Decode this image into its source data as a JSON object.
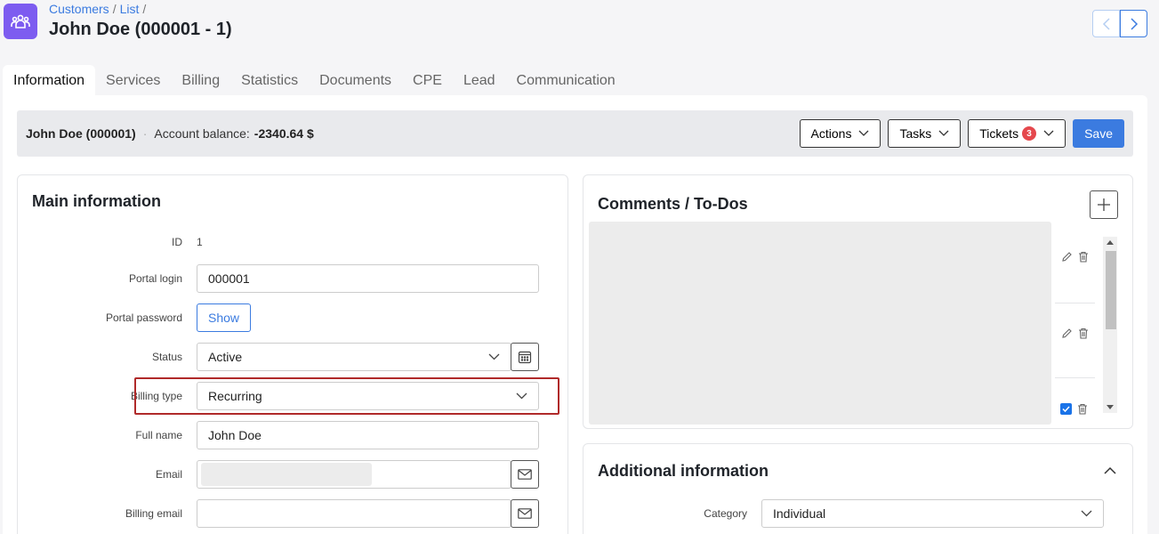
{
  "breadcrumb": {
    "customers": "Customers",
    "list": "List",
    "sep": "/"
  },
  "page": {
    "title": "John Doe (000001 - 1)"
  },
  "tabs": [
    {
      "label": "Information"
    },
    {
      "label": "Services"
    },
    {
      "label": "Billing"
    },
    {
      "label": "Statistics"
    },
    {
      "label": "Documents"
    },
    {
      "label": "CPE"
    },
    {
      "label": "Lead"
    },
    {
      "label": "Communication"
    }
  ],
  "account_bar": {
    "name": "John Doe (000001)",
    "balance_label": "Account balance:",
    "balance_value": "-2340.64 $",
    "actions_label": "Actions",
    "tasks_label": "Tasks",
    "tickets_label": "Tickets",
    "tickets_count": "3",
    "save_label": "Save"
  },
  "main_info": {
    "title": "Main information",
    "id_label": "ID",
    "id_value": "1",
    "portal_login_label": "Portal login",
    "portal_login_value": "000001",
    "portal_password_label": "Portal password",
    "show_label": "Show",
    "status_label": "Status",
    "status_value": "Active",
    "billing_type_label": "Billing type",
    "billing_type_value": "Recurring",
    "full_name_label": "Full name",
    "full_name_value": "John Doe",
    "email_label": "Email",
    "billing_email_label": "Billing email"
  },
  "comments": {
    "title": "Comments / To-Dos"
  },
  "additional": {
    "title": "Additional information",
    "category_label": "Category",
    "category_value": "Individual"
  },
  "colors": {
    "accent": "#3b7be0",
    "logo": "#7d5cf0",
    "badge": "#e5484d",
    "highlight": "#b02a2a"
  }
}
